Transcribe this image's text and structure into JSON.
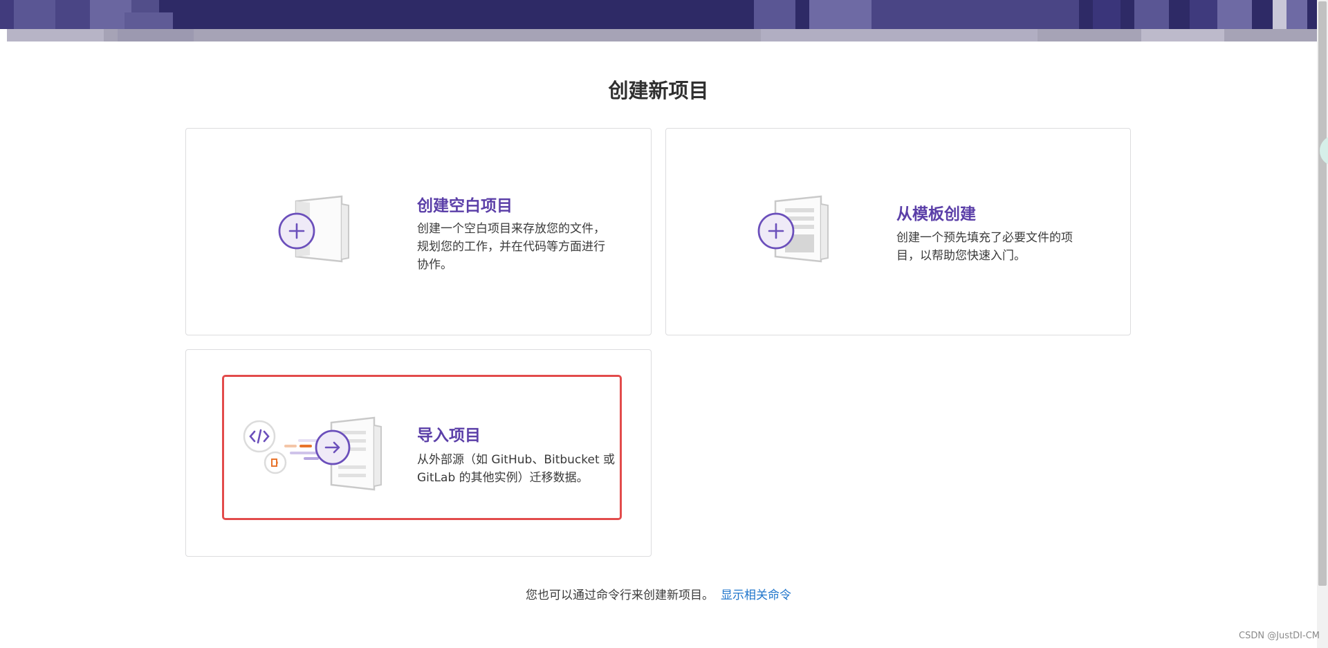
{
  "page": {
    "title": "创建新项目"
  },
  "cards": {
    "blank": {
      "title": "创建空白项目",
      "desc_line1": "创建一个空白项目来存放您的文件，",
      "desc_line2": "规划您的工作，并在代码等方面进行",
      "desc_line3": "协作。",
      "icon": "blank-project-illustration"
    },
    "template": {
      "title": "从模板创建",
      "desc_line1": "创建一个预先填充了必要文件的项",
      "desc_line2": "目，以帮助您快速入门。",
      "icon": "template-project-illustration"
    },
    "import": {
      "title": "导入项目",
      "desc_line1": "从外部源（如 GitHub、Bitbucket 或",
      "desc_line2": "GitLab 的其他实例）迁移数据。",
      "icon": "import-project-illustration"
    }
  },
  "footer": {
    "hint_text": "您也可以通过命令行来创建新项目。",
    "hint_link": "显示相关命令"
  },
  "watermark": "CSDN @JustDI-CM",
  "colors": {
    "header": "#2e2a66",
    "accent_purple": "#5b3fa8",
    "highlight_red": "#e24b4b",
    "link_blue": "#1f75cb",
    "import_orange": "#e8742c"
  }
}
